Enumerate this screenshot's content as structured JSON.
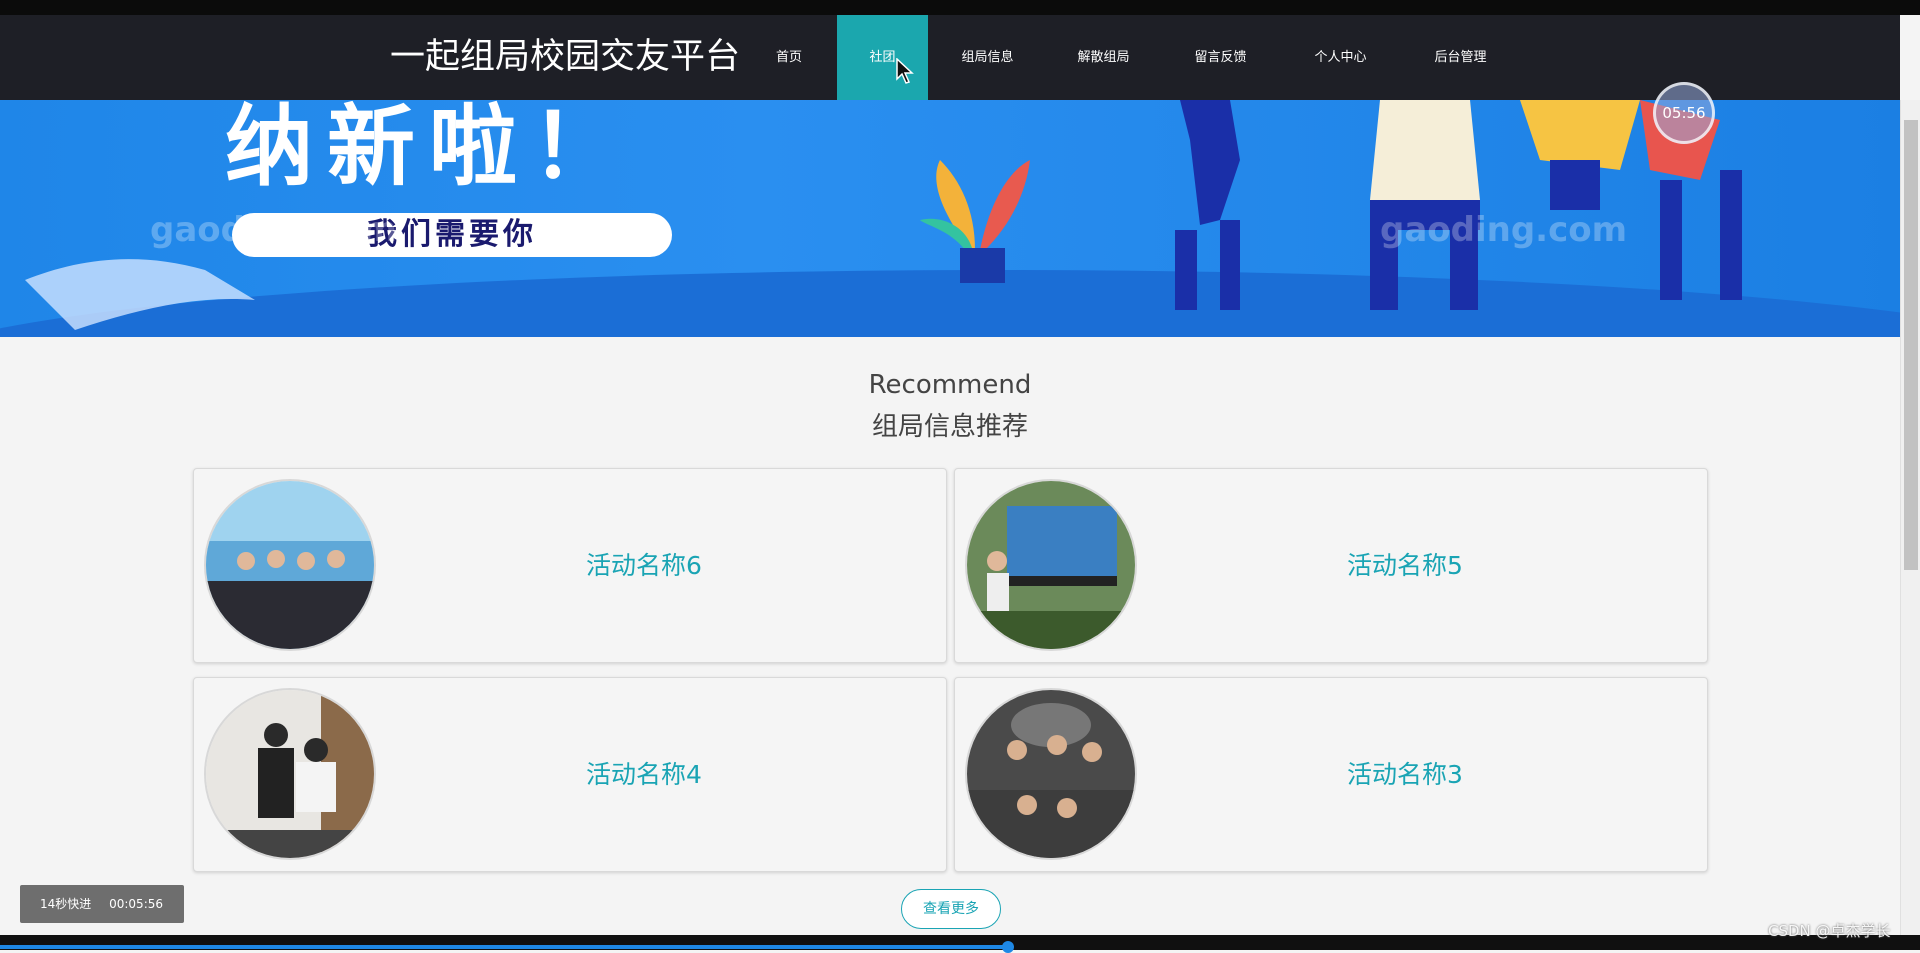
{
  "brand": "一起组局校园交友平台",
  "nav": [
    {
      "label": "首页"
    },
    {
      "label": "社团"
    },
    {
      "label": "组局信息"
    },
    {
      "label": "解散组局"
    },
    {
      "label": "留言反馈"
    },
    {
      "label": "个人中心"
    },
    {
      "label": "后台管理"
    }
  ],
  "nav_active": "社团",
  "banner": {
    "headline": "纳新啦！",
    "pill": "我们需要你",
    "watermark": "gaoding.com",
    "timer": "05:56"
  },
  "section": {
    "title_en": "Recommend",
    "title_cn": "组局信息推荐"
  },
  "cards": [
    {
      "title": "活动名称6"
    },
    {
      "title": "活动名称5"
    },
    {
      "title": "活动名称4"
    },
    {
      "title": "活动名称3"
    }
  ],
  "more_label": "查看更多",
  "player": {
    "skip_label": "14秒快进",
    "time": "00:05:56"
  },
  "credit": "CSDN @卓杰学长",
  "colors": {
    "accent": "#1ba7ae",
    "navbar": "#1e1f26",
    "card_title": "#1aa4b4",
    "banner_blue": "#1f86e8"
  }
}
